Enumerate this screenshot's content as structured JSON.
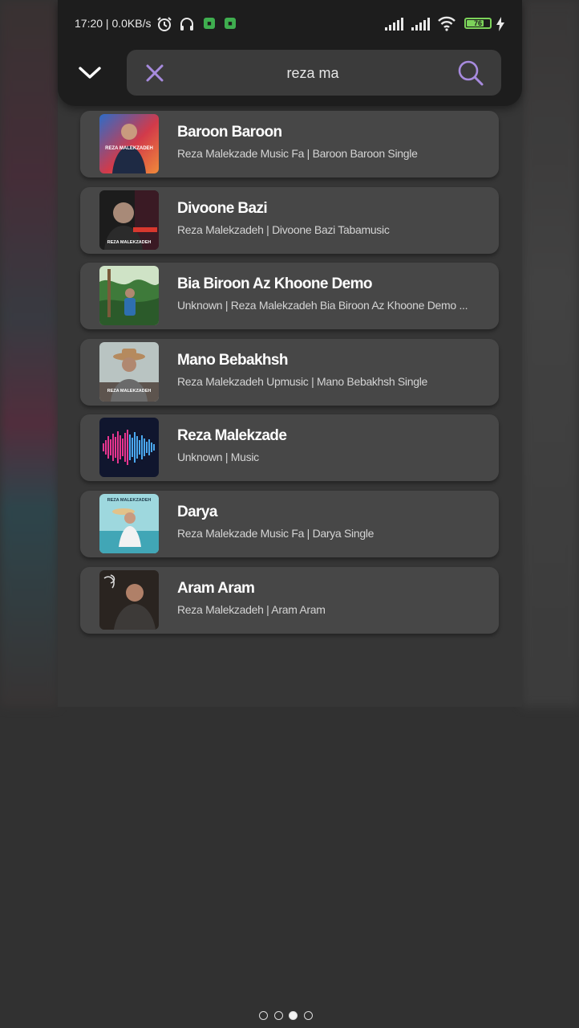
{
  "status_bar": {
    "time_network": "17:20 | 0.0KB/s",
    "battery_level": "76",
    "battery_fraction": 0.76,
    "icons": [
      "alarm-icon",
      "headphones-icon",
      "app-notification-icon",
      "app-notification-icon",
      "signal-icon",
      "signal-icon",
      "wifi-icon",
      "battery-icon",
      "charging-icon"
    ]
  },
  "search": {
    "query": "reza ma",
    "back_icon": "chevron-down-icon",
    "clear_icon": "close-icon",
    "search_icon": "search-icon"
  },
  "results": [
    {
      "title": "Baroon Baroon",
      "subtitle": "Reza Malekzade Music Fa | Baroon Baroon Single",
      "cover_text": "REZA MALEKZADEH"
    },
    {
      "title": "Divoone Bazi",
      "subtitle": "Reza Malekzadeh | Divoone Bazi Tabamusic",
      "cover_text": "REZA MALEKZADEH"
    },
    {
      "title": "Bia Biroon Az Khoone Demo",
      "subtitle": "Unknown | Reza Malekzadeh Bia Biroon Az Khoone Demo ...",
      "cover_text": ""
    },
    {
      "title": "Mano Bebakhsh",
      "subtitle": "Reza Malekzadeh Upmusic | Mano Bebakhsh Single",
      "cover_text": "REZA MALEKZADEH"
    },
    {
      "title": "Reza Malekzade",
      "subtitle": "Unknown | Music",
      "cover_text": ""
    },
    {
      "title": "Darya",
      "subtitle": "Reza Malekzade Music Fa | Darya Single",
      "cover_text": "REZA MALEKZADEH"
    },
    {
      "title": "Aram Aram",
      "subtitle": "Reza Malekzadeh | Aram Aram",
      "cover_text": ""
    }
  ],
  "pager": {
    "count": 4,
    "active_index": 2
  },
  "colors": {
    "accent": "#a78bde",
    "top_bar": "#1d1d1d",
    "card": "#474747",
    "panel": "#363636",
    "status_green": "#3fae4f",
    "battery_green": "#7cd35a"
  }
}
